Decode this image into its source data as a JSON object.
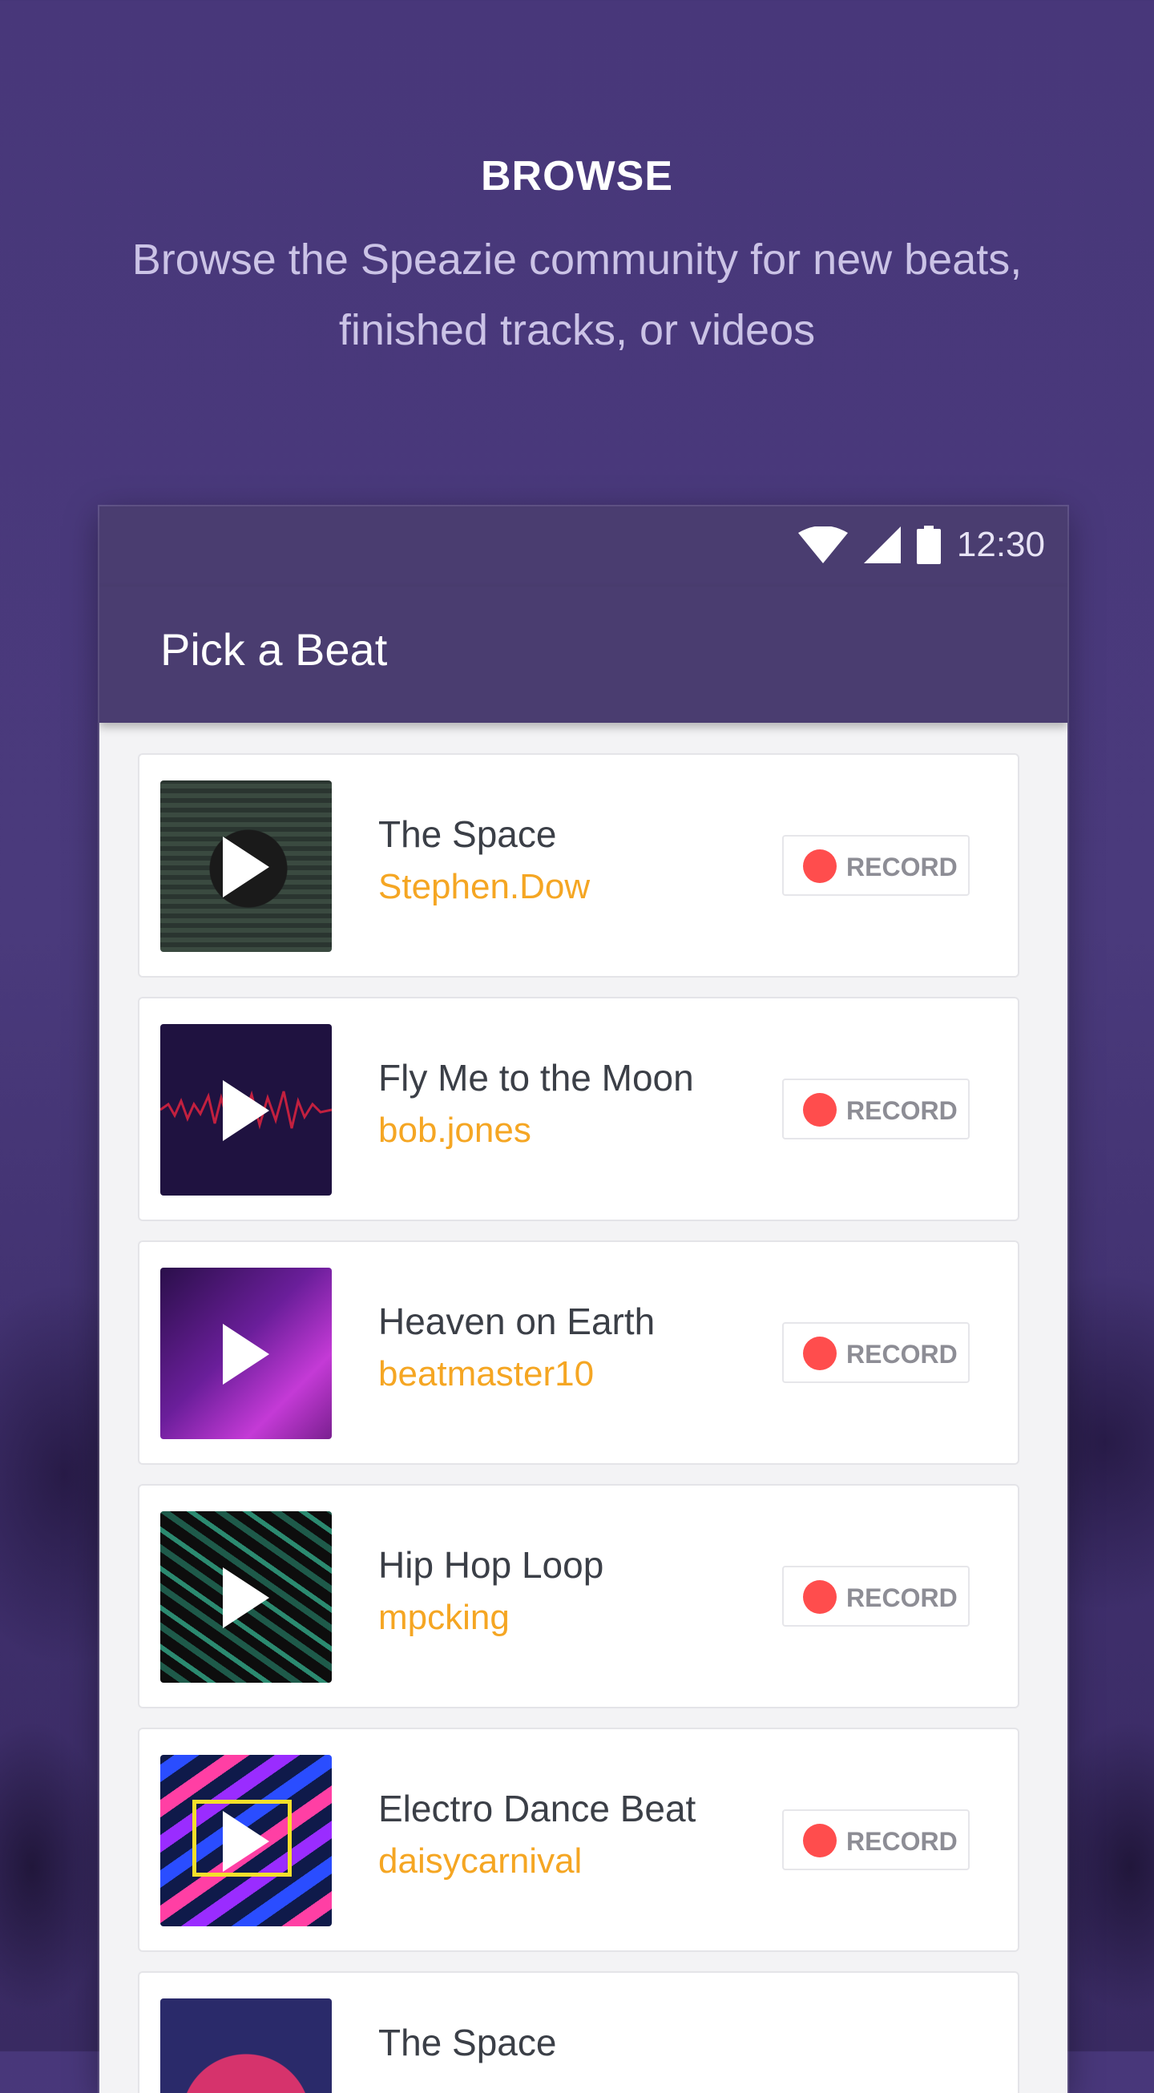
{
  "hero": {
    "title": "BROWSE",
    "subtitle": "Browse the Speazie community for new beats, finished tracks, or videos"
  },
  "statusbar": {
    "time": "12:30",
    "icons": [
      "wifi-icon",
      "signal-icon",
      "battery-icon"
    ]
  },
  "appbar": {
    "title": "Pick a Beat"
  },
  "record_label": "RECORD",
  "colors": {
    "background": "#48377a",
    "appbar": "#4a3d70",
    "artist": "#f5a623",
    "record_dot": "#ff4d4d"
  },
  "tracks": [
    {
      "title": "The Space",
      "artist": "Stephen.Dow",
      "art": "dark-silhouette"
    },
    {
      "title": "Fly Me to the Moon",
      "artist": "bob.jones",
      "art": "red-waveform"
    },
    {
      "title": "Heaven on Earth",
      "artist": "beatmaster10",
      "art": "purple-gradient"
    },
    {
      "title": "Hip Hop Loop",
      "artist": "mpcking",
      "art": "green-leaves"
    },
    {
      "title": "Electro Dance Beat",
      "artist": "daisycarnival",
      "art": "neon-stripes"
    },
    {
      "title": "The Space",
      "artist": "",
      "art": "pink-circle"
    }
  ]
}
